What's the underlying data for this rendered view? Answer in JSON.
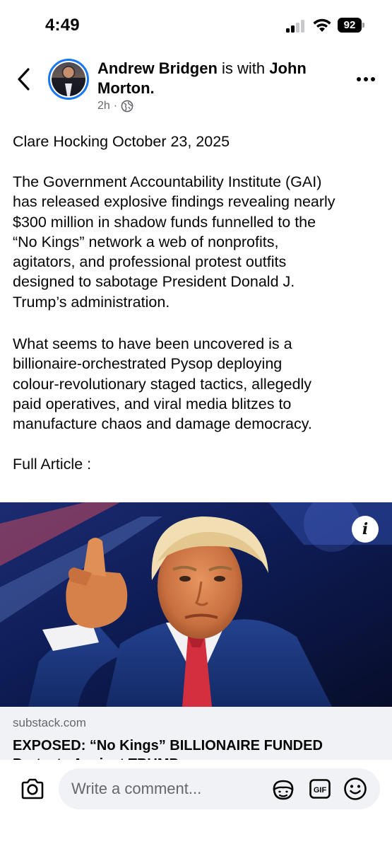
{
  "status_bar": {
    "time": "4:49",
    "battery": "92"
  },
  "post": {
    "author": "Andrew Bridgen",
    "with_text": "is with",
    "tagged": "John Morton",
    "timestamp": "2h",
    "separator": "·",
    "audience_icon": "globe-icon",
    "paragraphs": [
      "Clare Hocking October 23, 2025",
      "The Government Accountability Institute (GAI)\nhas released explosive findings revealing nearly\n$300 million in shadow funds funnelled to the\n“No Kings” network a web of nonprofits,\nagitators, and professional protest outfits\ndesigned to sabotage President Donald J.\nTrump’s administration.",
      "What seems to have been uncovered is a\nbillionaire-orchestrated Pysop deploying\ncolour-revolutionary staged tactics, allegedly\npaid operatives, and viral media blitzes to\nmanufacture chaos and damage democracy.",
      "Full Article :"
    ]
  },
  "link_preview": {
    "domain": "substack.com",
    "title": "EXPOSED: “No Kings” BILLIONAIRE FUNDED\nProtests Against TRUMP",
    "info_label": "i"
  },
  "comment_bar": {
    "placeholder": "Write a comment...",
    "gif_label": "GIF"
  },
  "colors": {
    "accent": "#1877f2",
    "secondary_text": "#65676b",
    "input_bg": "#f0f2f5"
  }
}
